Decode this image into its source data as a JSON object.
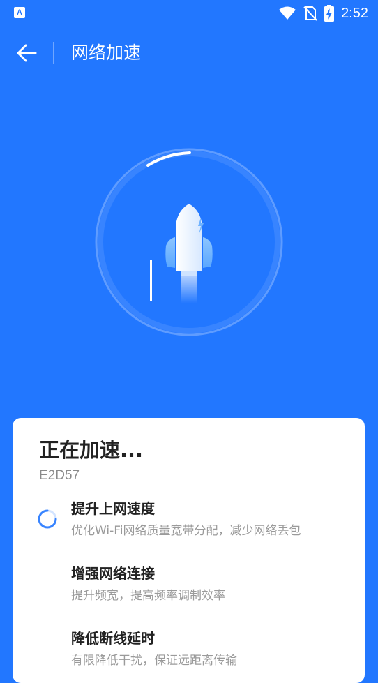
{
  "status_bar": {
    "app_icon_letter": "A",
    "time": "2:52",
    "icons": [
      "wifi-icon",
      "no-sim-icon",
      "battery-charging-icon"
    ]
  },
  "header": {
    "title": "网络加速",
    "back_icon": "arrow-left-icon"
  },
  "colors": {
    "background": "#2277ff",
    "card": "#ffffff",
    "spinner": "#2277ff"
  },
  "accelerate": {
    "status": "正在加速...",
    "code": "E2D57",
    "items": [
      {
        "title": "提升上网速度",
        "desc": "优化Wi-Fi网络质量宽带分配，减少网络丢包",
        "state": "loading"
      },
      {
        "title": "增强网络连接",
        "desc": "提升频宽，提高频率调制效率",
        "state": "pending"
      },
      {
        "title": "降低断线延时",
        "desc": "有限降低干扰，保证远距离传输",
        "state": "pending"
      }
    ]
  }
}
